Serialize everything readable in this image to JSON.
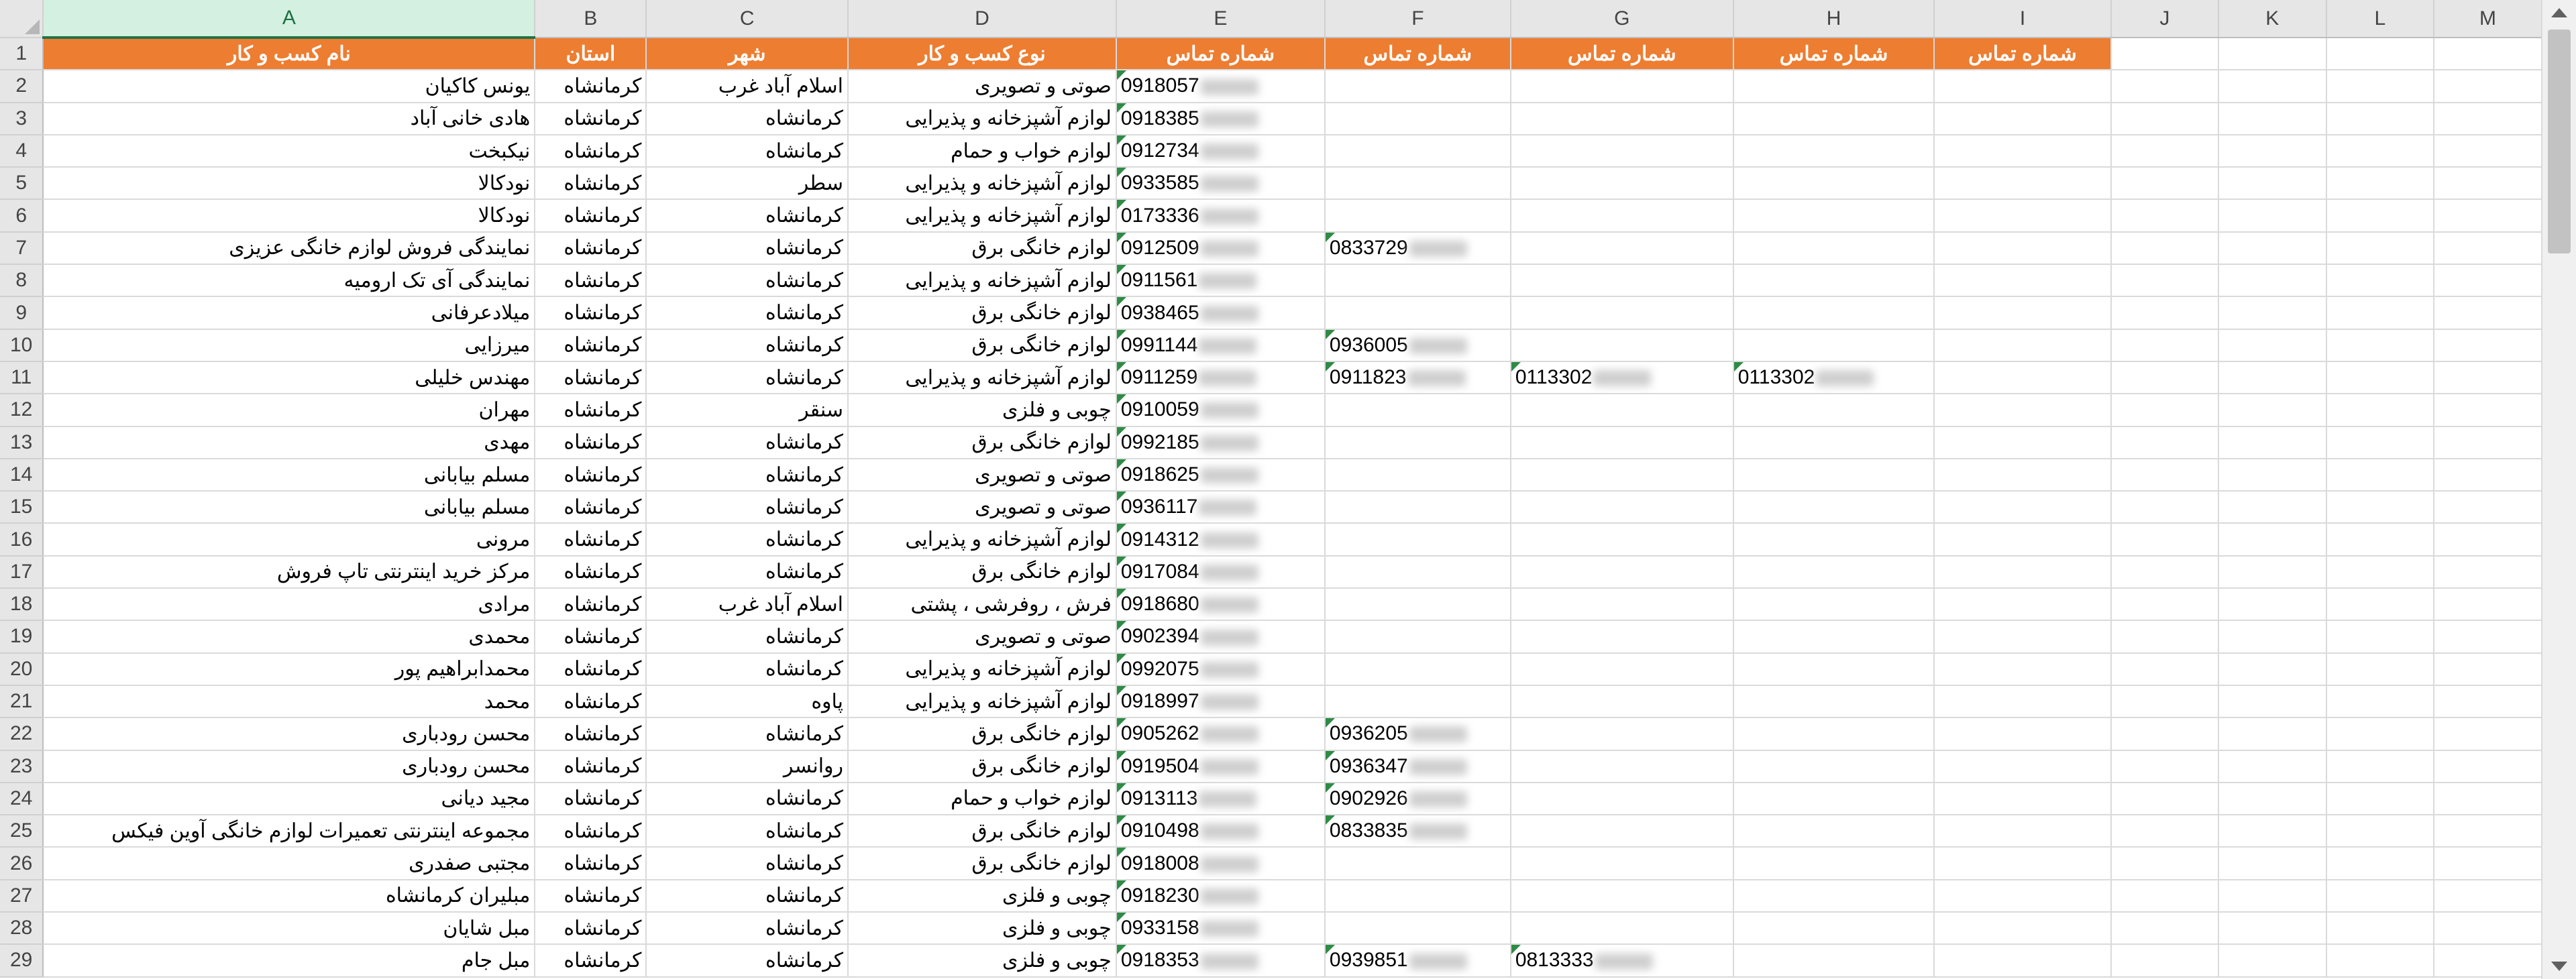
{
  "columns": [
    "A",
    "B",
    "C",
    "D",
    "E",
    "F",
    "G",
    "H",
    "I",
    "J",
    "K",
    "L",
    "M"
  ],
  "header": [
    "نام کسب و کار",
    "استان",
    "شهر",
    "نوع کسب و کار",
    "شماره تماس",
    "شماره تماس",
    "شماره تماس",
    "شماره تماس",
    "شماره تماس",
    "",
    "",
    "",
    ""
  ],
  "rows": [
    {
      "num": "2",
      "name": "یونس کاکیان",
      "province": "کرمانشاه",
      "city": "اسلام آباد غرب",
      "type": "صوتی و تصویری",
      "e": "0918057",
      "f": "",
      "g": "",
      "h": ""
    },
    {
      "num": "3",
      "name": "هادی خانی آباد",
      "province": "کرمانشاه",
      "city": "کرمانشاه",
      "type": "لوازم آشپزخانه و پذیرایی",
      "e": "0918385",
      "f": "",
      "g": "",
      "h": ""
    },
    {
      "num": "4",
      "name": "نیکبخت",
      "province": "کرمانشاه",
      "city": "کرمانشاه",
      "type": "لوازم خواب و حمام",
      "e": "0912734",
      "f": "",
      "g": "",
      "h": ""
    },
    {
      "num": "5",
      "name": "نودکالا",
      "province": "کرمانشاه",
      "city": "سطر",
      "type": "لوازم آشپزخانه و پذیرایی",
      "e": "0933585",
      "f": "",
      "g": "",
      "h": ""
    },
    {
      "num": "6",
      "name": "نودکالا",
      "province": "کرمانشاه",
      "city": "کرمانشاه",
      "type": "لوازم آشپزخانه و پذیرایی",
      "e": "0173336",
      "f": "",
      "g": "",
      "h": ""
    },
    {
      "num": "7",
      "name": "نمایندگی فروش لوازم خانگی عزیزی",
      "province": "کرمانشاه",
      "city": "کرمانشاه",
      "type": "لوازم خانگی برق",
      "e": "0912509",
      "f": "0833729",
      "g": "",
      "h": ""
    },
    {
      "num": "8",
      "name": "نمایندگی آی تک ارومیه",
      "province": "کرمانشاه",
      "city": "کرمانشاه",
      "type": "لوازم آشپزخانه و پذیرایی",
      "e": "0911561",
      "f": "",
      "g": "",
      "h": ""
    },
    {
      "num": "9",
      "name": "میلادعرفانی",
      "province": "کرمانشاه",
      "city": "کرمانشاه",
      "type": "لوازم خانگی برق",
      "e": "0938465",
      "f": "",
      "g": "",
      "h": ""
    },
    {
      "num": "10",
      "name": "میرزایی",
      "province": "کرمانشاه",
      "city": "کرمانشاه",
      "type": "لوازم خانگی برق",
      "e": "0991144",
      "f": "0936005",
      "g": "",
      "h": ""
    },
    {
      "num": "11",
      "name": "مهندس خلیلی",
      "province": "کرمانشاه",
      "city": "کرمانشاه",
      "type": "لوازم آشپزخانه و پذیرایی",
      "e": "0911259",
      "f": "0911823",
      "g": "0113302",
      "h": "0113302"
    },
    {
      "num": "12",
      "name": "مهران",
      "province": "کرمانشاه",
      "city": "سنقر",
      "type": "چوبی و فلزی",
      "e": "0910059",
      "f": "",
      "g": "",
      "h": ""
    },
    {
      "num": "13",
      "name": "مهدی",
      "province": "کرمانشاه",
      "city": "کرمانشاه",
      "type": "لوازم خانگی برق",
      "e": "0992185",
      "f": "",
      "g": "",
      "h": ""
    },
    {
      "num": "14",
      "name": "مسلم بیابانی",
      "province": "کرمانشاه",
      "city": "کرمانشاه",
      "type": "صوتی و تصویری",
      "e": "0918625",
      "f": "",
      "g": "",
      "h": ""
    },
    {
      "num": "15",
      "name": "مسلم بیابانی",
      "province": "کرمانشاه",
      "city": "کرمانشاه",
      "type": "صوتی و تصویری",
      "e": "0936117",
      "f": "",
      "g": "",
      "h": ""
    },
    {
      "num": "16",
      "name": "مرونی",
      "province": "کرمانشاه",
      "city": "کرمانشاه",
      "type": "لوازم آشپزخانه و پذیرایی",
      "e": "0914312",
      "f": "",
      "g": "",
      "h": ""
    },
    {
      "num": "17",
      "name": "مرکز خرید اینترنتی تاپ فروش",
      "province": "کرمانشاه",
      "city": "کرمانشاه",
      "type": "لوازم خانگی برق",
      "e": "0917084",
      "f": "",
      "g": "",
      "h": ""
    },
    {
      "num": "18",
      "name": "مرادی",
      "province": "کرمانشاه",
      "city": "اسلام آباد غرب",
      "type": "فرش ، روفرشی ، پشتی",
      "e": "0918680",
      "f": "",
      "g": "",
      "h": ""
    },
    {
      "num": "19",
      "name": "محمدی",
      "province": "کرمانشاه",
      "city": "کرمانشاه",
      "type": "صوتی و تصویری",
      "e": "0902394",
      "f": "",
      "g": "",
      "h": ""
    },
    {
      "num": "20",
      "name": "محمدابراهیم پور",
      "province": "کرمانشاه",
      "city": "کرمانشاه",
      "type": "لوازم آشپزخانه و پذیرایی",
      "e": "0992075",
      "f": "",
      "g": "",
      "h": ""
    },
    {
      "num": "21",
      "name": "محمد",
      "province": "کرمانشاه",
      "city": "پاوه",
      "type": "لوازم آشپزخانه و پذیرایی",
      "e": "0918997",
      "f": "",
      "g": "",
      "h": ""
    },
    {
      "num": "22",
      "name": "محسن رودباری",
      "province": "کرمانشاه",
      "city": "کرمانشاه",
      "type": "لوازم خانگی برق",
      "e": "0905262",
      "f": "0936205",
      "g": "",
      "h": ""
    },
    {
      "num": "23",
      "name": "محسن رودباری",
      "province": "کرمانشاه",
      "city": "روانسر",
      "type": "لوازم خانگی برق",
      "e": "0919504",
      "f": "0936347",
      "g": "",
      "h": ""
    },
    {
      "num": "24",
      "name": "مجید دیانی",
      "province": "کرمانشاه",
      "city": "کرمانشاه",
      "type": "لوازم خواب و حمام",
      "e": "0913113",
      "f": "0902926",
      "g": "",
      "h": ""
    },
    {
      "num": "25",
      "name": "مجموعه اینترنتی تعمیرات لوازم خانگی آوین فیکس",
      "province": "کرمانشاه",
      "city": "کرمانشاه",
      "type": "لوازم خانگی برق",
      "e": "0910498",
      "f": "0833835",
      "g": "",
      "h": ""
    },
    {
      "num": "26",
      "name": "مجتبی صفدری",
      "province": "کرمانشاه",
      "city": "کرمانشاه",
      "type": "لوازم خانگی برق",
      "e": "0918008",
      "f": "",
      "g": "",
      "h": ""
    },
    {
      "num": "27",
      "name": "مبلیران کرمانشاه",
      "province": "کرمانشاه",
      "city": "کرمانشاه",
      "type": "چوبی و فلزی",
      "e": "0918230",
      "f": "",
      "g": "",
      "h": ""
    },
    {
      "num": "28",
      "name": "مبل شایان",
      "province": "کرمانشاه",
      "city": "کرمانشاه",
      "type": "چوبی و فلزی",
      "e": "0933158",
      "f": "",
      "g": "",
      "h": ""
    },
    {
      "num": "29",
      "name": "مبل جام",
      "province": "کرمانشاه",
      "city": "کرمانشاه",
      "type": "چوبی و فلزی",
      "e": "0918353",
      "f": "0939851",
      "g": "0813333",
      "h": ""
    }
  ]
}
